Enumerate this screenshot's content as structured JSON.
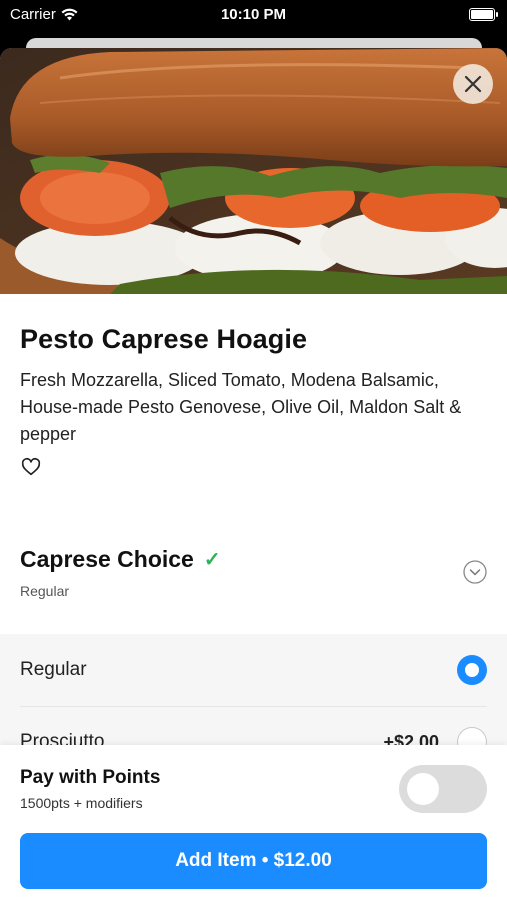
{
  "status_bar": {
    "carrier": "Carrier",
    "time": "10:10 PM"
  },
  "product": {
    "title": "Pesto Caprese Hoagie",
    "description": "Fresh Mozzarella, Sliced Tomato, Modena Balsamic, House-made Pesto Genovese, Olive Oil, Maldon Salt & pepper",
    "favorite_icon": "heart-outline-icon"
  },
  "modifier_group": {
    "title": "Caprese Choice",
    "selection": "Regular",
    "status_icon": "checkmark-icon",
    "collapse_icon": "chevron-down-circle-icon",
    "options": [
      {
        "label": "Regular",
        "price": "",
        "selected": true
      },
      {
        "label": "Prosciutto",
        "price": "+$2.00",
        "selected": false
      }
    ]
  },
  "bottom_bar": {
    "points_title": "Pay with Points",
    "points_subtitle": "1500pts + modifiers",
    "points_toggle_on": false,
    "add_button_label": "Add Item • $12.00"
  },
  "colors": {
    "accent": "#1a8cff",
    "success": "#2db45a"
  }
}
